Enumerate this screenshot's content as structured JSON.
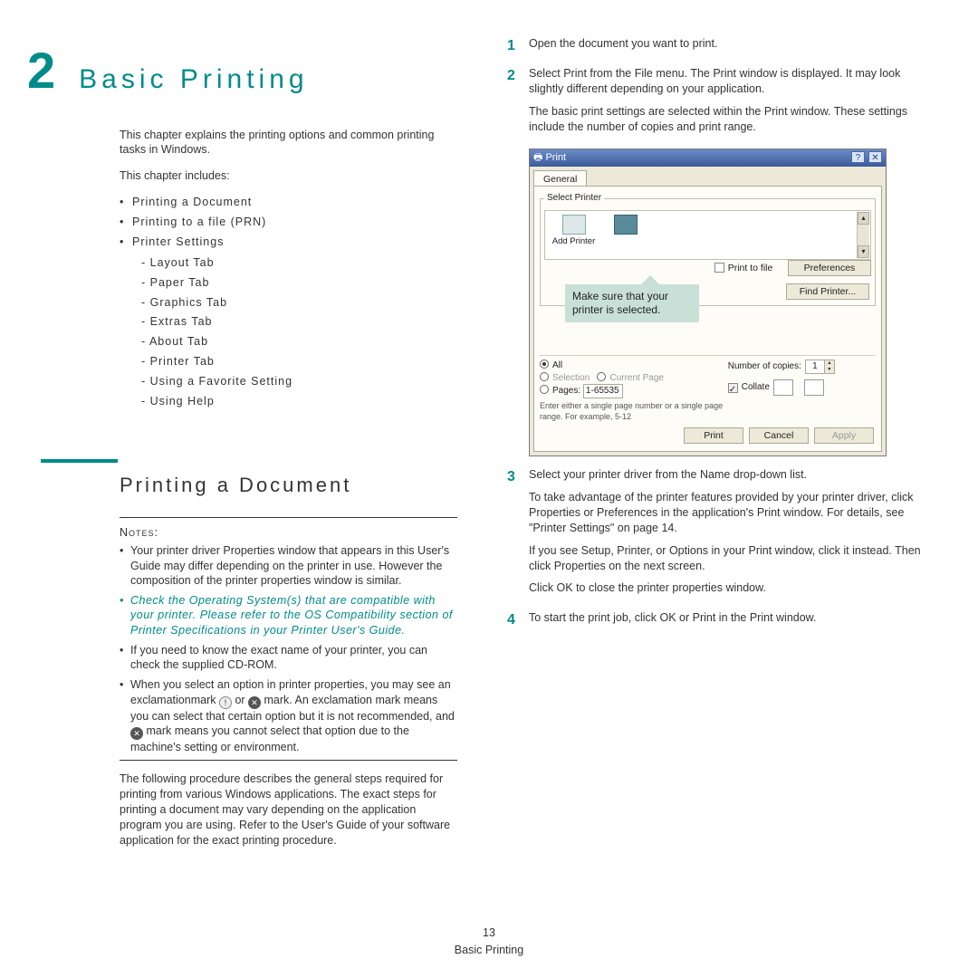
{
  "chapter": {
    "number": "2",
    "title": "Basic Printing"
  },
  "intro": "This chapter explains the printing options and common printing tasks in Windows.",
  "includes_label": "This chapter includes:",
  "toc": {
    "items": [
      "Printing a Document",
      "Printing to a file (PRN)",
      "Printer Settings"
    ],
    "sub": [
      "Layout Tab",
      "Paper Tab",
      "Graphics Tab",
      "Extras Tab",
      "About Tab",
      "Printer Tab",
      "Using a Favorite Setting",
      "Using Help"
    ]
  },
  "section_title": "Printing a Document",
  "notes_label": "Notes:",
  "notes": {
    "n1": "Your printer driver Properties window that appears in this User's Guide may differ depending on the printer in use. However the composition of the printer properties window is similar.",
    "n2": "Check the Operating System(s) that are compatible with your printer. Please refer to the OS Compatibility section of Printer Specifications in your Printer User's Guide.",
    "n3": "If you need to know the exact name of your printer, you can check the supplied CD-ROM.",
    "n4a": "When you select an option in printer properties, you may see an exclamationmark ",
    "n4mid": " or ",
    "n4b": " mark. An exclamation mark means you can select that certain option but it is not recommended, and ",
    "n4c": " mark means you cannot select that option due to the machine's setting or environment."
  },
  "procedure_intro": "The following procedure describes the general steps required for printing from various Windows applications. The exact steps for printing a document may vary depending on the application program you are using. Refer to the User's Guide of your software application for the exact printing procedure.",
  "steps": {
    "s1": "Open the document you want to print.",
    "s2a": "Select Print from the File menu. The Print window is displayed. It may look slightly different depending on your application.",
    "s2b": "The basic print settings are selected within the Print window. These settings include the number of copies and print range.",
    "s3a": "Select your printer driver from the Name drop-down list.",
    "s3b": "To take advantage of the printer features provided by your printer driver, click Properties or Preferences in the application's Print window. For details, see \"Printer Settings\" on page 14.",
    "s3c": "If you see Setup, Printer, or Options in your Print window, click it instead. Then click Properties on the next screen.",
    "s3d": "Click OK to close the printer properties window.",
    "s4": "To start the print job, click OK or Print in the Print window."
  },
  "dialog": {
    "title": "Print",
    "tab": "General",
    "select_printer": "Select Printer",
    "add_printer": "Add Printer",
    "hint": "Make sure that your printer is selected.",
    "print_to_file": "Print to file",
    "preferences": "Preferences",
    "find_printer": "Find Printer...",
    "all": "All",
    "selection": "Selection",
    "current_page": "Current Page",
    "pages": "Pages:",
    "pages_value": "1-65535",
    "pages_hint": "Enter either a single page number or a single page range. For example, 5-12",
    "copies_label": "Number of copies:",
    "copies_value": "1",
    "collate": "Collate",
    "print_btn": "Print",
    "cancel_btn": "Cancel",
    "apply_btn": "Apply"
  },
  "footer": {
    "page": "13",
    "chapter": "Basic Printing"
  }
}
